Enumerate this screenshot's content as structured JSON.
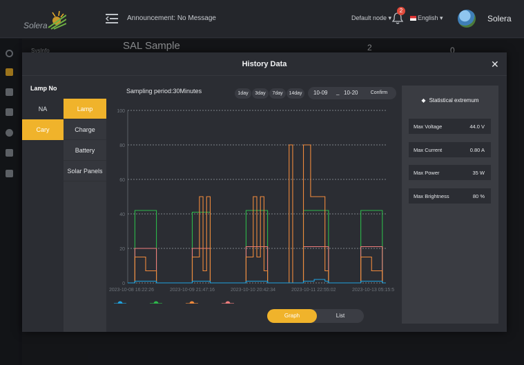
{
  "header": {
    "logo_text": "Solera",
    "announcement": "Announcement: No Message",
    "node_select": "Default node",
    "notification_count": "2",
    "language": "English",
    "username": "Solera"
  },
  "background": {
    "page_title": "SAL Sample",
    "sub_label": "SysInfo",
    "stat_a": "2",
    "stat_b": "0"
  },
  "modal": {
    "title": "History Data",
    "lamp_column_title": "Lamp No",
    "lamps": [
      "NA",
      "Cary"
    ],
    "active_lamp": "Cary",
    "types": [
      "Lamp",
      "Charge",
      "Battery",
      "Solar Panels"
    ],
    "active_type": "Lamp",
    "sampling": "Sampling period:30Minutes",
    "range_buttons": [
      "1day",
      "3day",
      "7day",
      "14day"
    ],
    "date_from": "10-09",
    "date_separator": "_",
    "date_to": "10-20",
    "confirm_label": "Confirm",
    "view_graph": "Graph",
    "view_list": "List",
    "stats": {
      "title": "Statistical extremum",
      "rows": [
        {
          "label": "Max Voltage",
          "value": "44.0 V"
        },
        {
          "label": "Max Current",
          "value": "0.80 A"
        },
        {
          "label": "Max Power",
          "value": "35 W"
        },
        {
          "label": "Max Brightness",
          "value": "80 %"
        }
      ]
    }
  },
  "colors": {
    "accent": "#f0b32b",
    "series_blue": "#1fa3e0",
    "series_green": "#2db84b",
    "series_orange": "#f08a3c",
    "series_pink": "#f07d7d"
  },
  "chart_data": {
    "type": "line",
    "ylim": [
      0,
      100
    ],
    "yticks": [
      0,
      20,
      40,
      60,
      80,
      100
    ],
    "x_tick_labels": [
      "2023-10-08 16:22:26",
      "2023-10-09 21:47:16",
      "2023-10-10 20:42:34",
      "2023-10-11 22:55:02",
      "2023-10-13 05:15:5"
    ],
    "grid": "horizontal dashed",
    "legend": "bottom",
    "series": [
      {
        "color": "#2db84b",
        "values": [
          0,
          0,
          42,
          42,
          42,
          42,
          42,
          42,
          0,
          0,
          0,
          0,
          0,
          0,
          0,
          0,
          0,
          0,
          41,
          41,
          41,
          41,
          41,
          0,
          0,
          0,
          0,
          0,
          0,
          0,
          0,
          0,
          0,
          42,
          42,
          42,
          42,
          42,
          42,
          0,
          0,
          0,
          0,
          0,
          0,
          0,
          0,
          0,
          0,
          42,
          42,
          42,
          42,
          42,
          42,
          42,
          0,
          0,
          0,
          0,
          0,
          0,
          0,
          0,
          0,
          42,
          42,
          42,
          42,
          42,
          42,
          0,
          0
        ]
      },
      {
        "color": "#f07d7d",
        "values": [
          0,
          0,
          20,
          20,
          20,
          20,
          20,
          20,
          0,
          0,
          0,
          0,
          0,
          0,
          0,
          0,
          0,
          0,
          20,
          20,
          20,
          20,
          20,
          0,
          0,
          0,
          0,
          0,
          0,
          0,
          0,
          0,
          0,
          21,
          21,
          21,
          21,
          21,
          21,
          0,
          0,
          0,
          0,
          0,
          0,
          0,
          0,
          0,
          0,
          21,
          21,
          21,
          21,
          21,
          21,
          21,
          0,
          0,
          0,
          0,
          0,
          0,
          0,
          0,
          0,
          21,
          21,
          21,
          21,
          21,
          21,
          0,
          0
        ]
      },
      {
        "color": "#f08a3c",
        "values": [
          0,
          0,
          15,
          15,
          15,
          7,
          7,
          7,
          0,
          0,
          0,
          0,
          0,
          0,
          0,
          0,
          0,
          0,
          15,
          15,
          50,
          7,
          50,
          0,
          0,
          0,
          0,
          0,
          0,
          0,
          0,
          0,
          0,
          15,
          15,
          50,
          15,
          50,
          7,
          0,
          0,
          0,
          0,
          0,
          0,
          80,
          0,
          0,
          0,
          80,
          80,
          50,
          50,
          50,
          50,
          7,
          0,
          0,
          0,
          0,
          0,
          0,
          0,
          0,
          0,
          15,
          15,
          15,
          7,
          7,
          7,
          0,
          0
        ]
      },
      {
        "color": "#1fa3e0",
        "values": [
          0,
          0,
          1,
          1,
          1,
          1,
          1,
          1,
          0,
          0,
          0,
          0,
          0,
          0,
          0,
          0,
          0,
          0,
          1,
          1,
          1,
          1,
          1,
          0,
          0,
          0,
          0,
          0,
          0,
          0,
          0,
          0,
          0,
          1,
          1,
          1,
          1,
          1,
          1,
          0,
          0,
          0,
          0,
          0,
          0,
          0,
          0,
          0,
          0,
          1,
          1,
          1,
          2,
          2,
          2,
          1,
          0,
          0,
          0,
          0,
          0,
          0,
          0,
          0,
          0,
          1,
          1,
          1,
          1,
          1,
          1,
          0,
          0
        ]
      }
    ]
  }
}
